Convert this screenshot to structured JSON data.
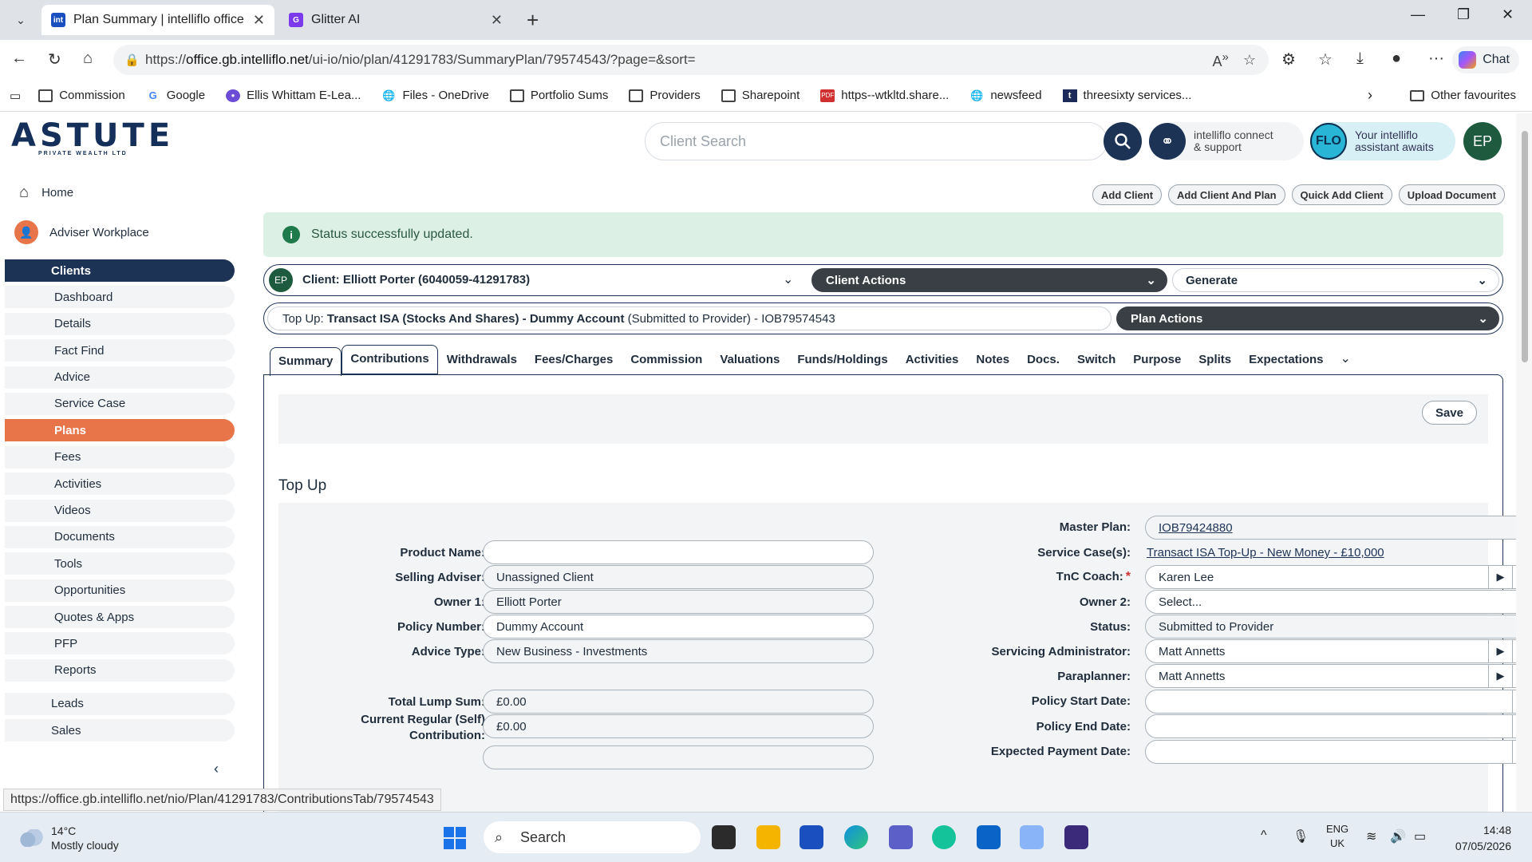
{
  "browser": {
    "tabs": [
      {
        "title": "Plan Summary | intelliflo office",
        "favicon": "int"
      },
      {
        "title": "Glitter AI",
        "favicon": "G"
      }
    ],
    "url_prefix": "https://",
    "url_host": "office.gb.intelliflo.net",
    "url_path": "/ui-io/nio/plan/41291783/SummaryPlan/79574543/?page=&sort=",
    "chat_label": "Chat",
    "bookmarks": [
      "Commission",
      "Google",
      "Ellis Whittam E-Lea...",
      "Files - OneDrive",
      "Portfolio Sums",
      "Providers",
      "Sharepoint",
      "https--wtkltd.share...",
      "newsfeed",
      "threesixty services..."
    ],
    "other_favourites": "Other favourites",
    "status_url": "https://office.gb.intelliflo.net/nio/Plan/41291783/ContributionsTab/79574543"
  },
  "app": {
    "logo_text": "ASTUTE",
    "logo_sub": "PRIVATE WEALTH LTD",
    "search_placeholder": "Client Search",
    "connect_line1": "intelliflo connect",
    "connect_line2": "& support",
    "flo_badge": "FLO",
    "flo_line1": "Your intelliflo",
    "flo_line2": "assistant awaits",
    "user_initials": "EP",
    "action_buttons": [
      "Add Client",
      "Add Client And Plan",
      "Quick Add Client",
      "Upload Document"
    ],
    "alert": "Status successfully updated.",
    "client_label": "Client: Elliott Porter (6040059-41291783)",
    "client_actions": "Client Actions",
    "generate": "Generate",
    "plan_prefix": "Top Up: ",
    "plan_name": "Transact ISA (Stocks And Shares) - Dummy Account",
    "plan_suffix": " (Submitted to Provider) - IOB79574543",
    "plan_actions": "Plan Actions",
    "tabs": [
      "Summary",
      "Contributions",
      "Withdrawals",
      "Fees/Charges",
      "Commission",
      "Valuations",
      "Funds/Holdings",
      "Activities",
      "Notes",
      "Docs.",
      "Switch",
      "Purpose",
      "Splits",
      "Expectations"
    ],
    "save": "Save",
    "section_title": "Top Up"
  },
  "sidebar": {
    "home": "Home",
    "adviser": "Adviser Workplace",
    "clients": "Clients",
    "items": [
      "Dashboard",
      "Details",
      "Fact Find",
      "Advice",
      "Service Case",
      "Plans",
      "Fees",
      "Activities",
      "Videos",
      "Documents",
      "Tools",
      "Opportunities",
      "Quotes & Apps",
      "PFP",
      "Reports"
    ],
    "leads": "Leads",
    "sales": "Sales"
  },
  "form": {
    "left": [
      {
        "label": "Product Name:",
        "value": ""
      },
      {
        "label": "Selling Adviser:",
        "value": "Unassigned Client"
      },
      {
        "label": "Owner 1:",
        "value": "Elliott Porter"
      },
      {
        "label": "Policy Number:",
        "value": "Dummy Account"
      },
      {
        "label": "Advice Type:",
        "value": "New Business - Investments"
      },
      {
        "label": "Total Lump Sum:",
        "value": "£0.00"
      },
      {
        "label": "Current Regular (Self)",
        "label2": "Contribution:",
        "value": "£0.00"
      }
    ],
    "right": [
      {
        "label": "Master Plan:",
        "value": "IOB79424880"
      },
      {
        "label": "Service Case(s):",
        "value": "Transact ISA Top-Up - New Money - £10,000"
      },
      {
        "label": "TnC Coach:",
        "value": "Karen Lee"
      },
      {
        "label": "Owner 2:",
        "value": "Select..."
      },
      {
        "label": "Status:",
        "value": "Submitted to Provider"
      },
      {
        "label": "Servicing Administrator:",
        "value": "Matt Annetts"
      },
      {
        "label": "Paraplanner:",
        "value": "Matt Annetts"
      },
      {
        "label": "Policy Start Date:",
        "value": ""
      },
      {
        "label": "Policy End Date:",
        "value": ""
      },
      {
        "label": "Expected Payment Date:",
        "value": ""
      }
    ]
  },
  "taskbar": {
    "temp": "14°C",
    "weather": "Mostly cloudy",
    "search": "Search",
    "lang1": "ENG",
    "lang2": "UK",
    "time": "14:48",
    "date": "07/05/2026"
  }
}
